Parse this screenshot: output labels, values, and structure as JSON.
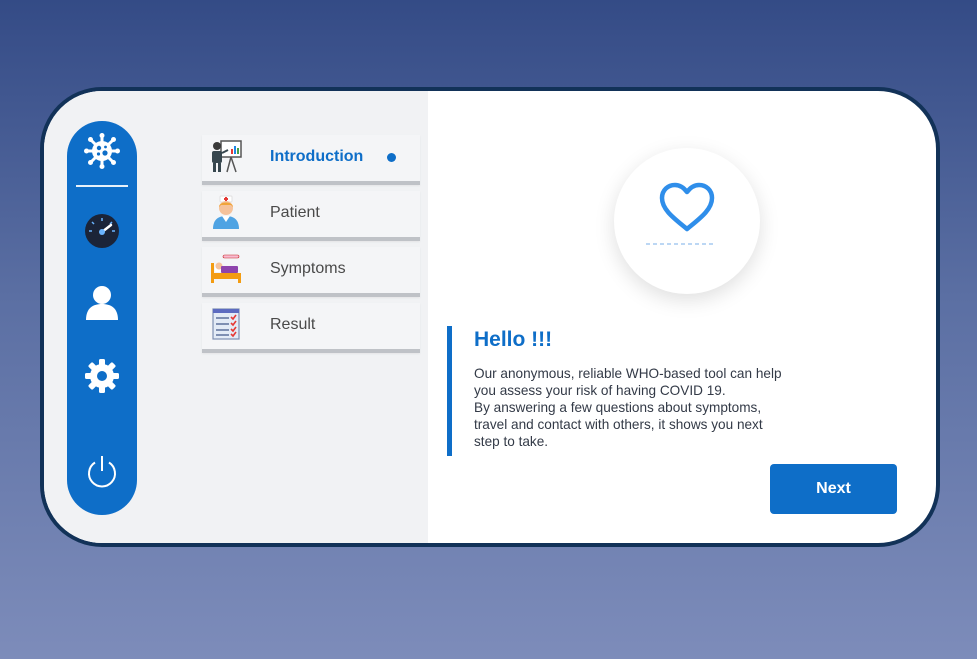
{
  "colors": {
    "accent": "#0e6ec8",
    "frame": "#123258",
    "panel_bg": "#f1f2f4",
    "text_dark": "#333a47"
  },
  "sidebar": {
    "icons": [
      {
        "name": "virus-icon"
      },
      {
        "name": "dashboard-gauge-icon"
      },
      {
        "name": "user-icon"
      },
      {
        "name": "settings-gear-icon"
      },
      {
        "name": "power-icon"
      }
    ]
  },
  "menu": {
    "items": [
      {
        "label": "Introduction",
        "icon": "presentation-icon",
        "active": true
      },
      {
        "label": "Patient",
        "icon": "nurse-avatar-icon",
        "active": false
      },
      {
        "label": "Symptoms",
        "icon": "sick-bed-icon",
        "active": false
      },
      {
        "label": "Result",
        "icon": "checklist-icon",
        "active": false
      }
    ]
  },
  "main": {
    "heart_icon": "heart-icon",
    "title": "Hello !!!",
    "body": "Our anonymous, reliable WHO-based tool can help\nyou assess your risk of having COVID 19.\nBy answering a few questions about symptoms,\ntravel and contact with others, it shows you next\nstep to take.",
    "next_label": "Next"
  }
}
